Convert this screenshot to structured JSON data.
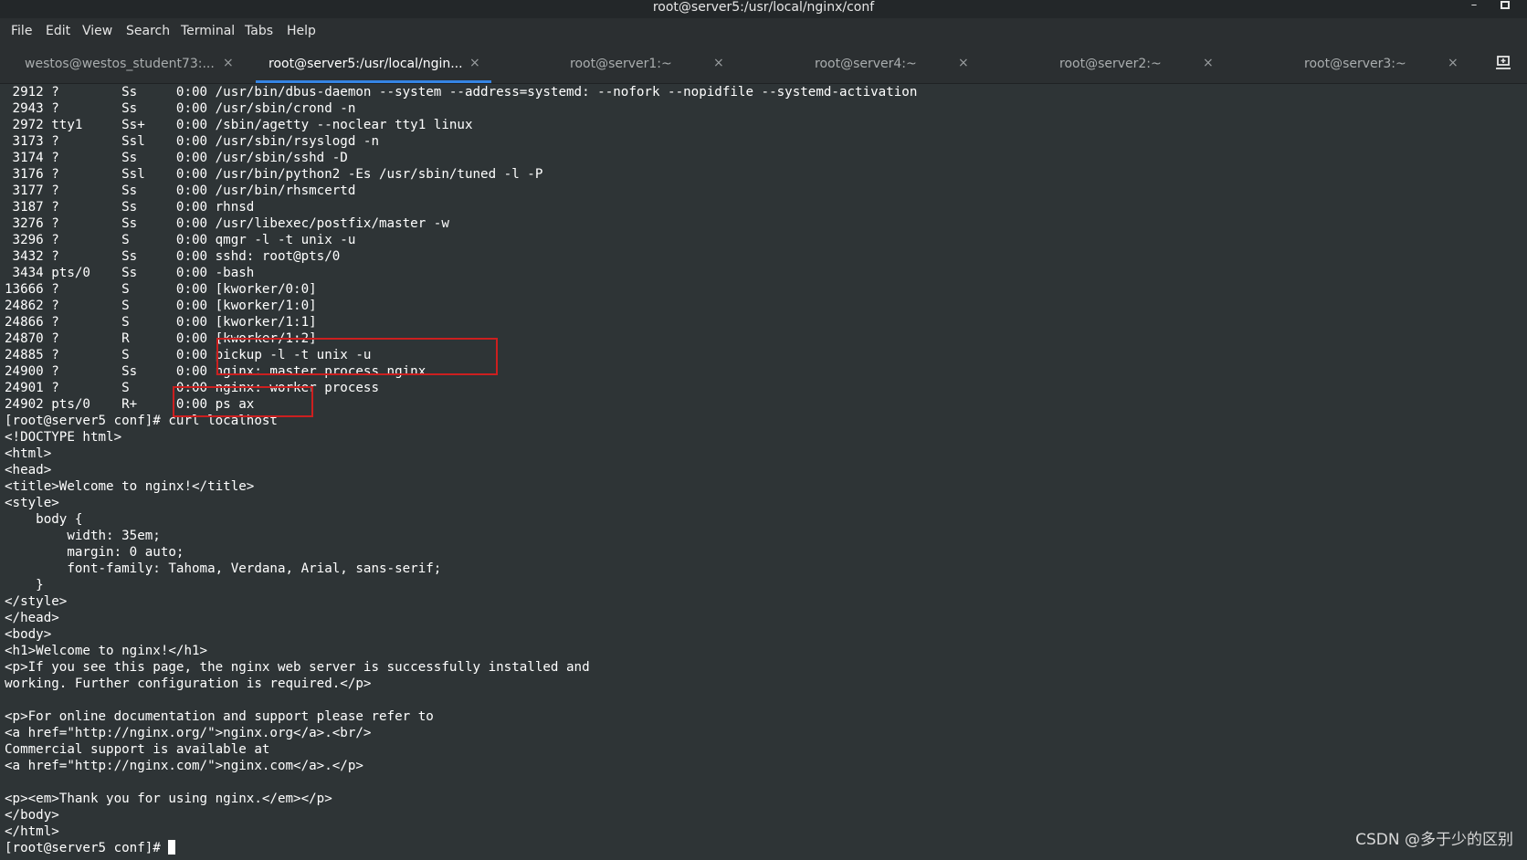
{
  "window": {
    "title": "root@server5:/usr/local/nginx/conf",
    "minimize_glyph": "–",
    "maximize_glyph": "▫"
  },
  "menu": [
    "File",
    "Edit",
    "View",
    "Search",
    "Terminal",
    "Tabs",
    "Help"
  ],
  "tabs": [
    {
      "label": "westos@westos_student73:...",
      "active": false
    },
    {
      "label": "root@server5:/usr/local/ngin...",
      "active": true
    },
    {
      "label": "root@server1:~",
      "active": false
    },
    {
      "label": "root@server4:~",
      "active": false
    },
    {
      "label": "root@server2:~",
      "active": false
    },
    {
      "label": "root@server3:~",
      "active": false
    }
  ],
  "tab_close_glyph": "×",
  "accent_color": "#3584e4",
  "highlight_color": "#cc1f1f",
  "terminal": {
    "lines": [
      " 2912 ?        Ss     0:00 /usr/bin/dbus-daemon --system --address=systemd: --nofork --nopidfile --systemd-activation",
      " 2943 ?        Ss     0:00 /usr/sbin/crond -n",
      " 2972 tty1     Ss+    0:00 /sbin/agetty --noclear tty1 linux",
      " 3173 ?        Ssl    0:00 /usr/sbin/rsyslogd -n",
      " 3174 ?        Ss     0:00 /usr/sbin/sshd -D",
      " 3176 ?        Ssl    0:00 /usr/bin/python2 -Es /usr/sbin/tuned -l -P",
      " 3177 ?        Ss     0:00 /usr/bin/rhsmcertd",
      " 3187 ?        Ss     0:00 rhnsd",
      " 3276 ?        Ss     0:00 /usr/libexec/postfix/master -w",
      " 3296 ?        S      0:00 qmgr -l -t unix -u",
      " 3432 ?        Ss     0:00 sshd: root@pts/0",
      " 3434 pts/0    Ss     0:00 -bash",
      "13666 ?        S      0:00 [kworker/0:0]",
      "24862 ?        S      0:00 [kworker/1:0]",
      "24866 ?        S      0:00 [kworker/1:1]",
      "24870 ?        R      0:00 [kworker/1:2]",
      "24885 ?        S      0:00 pickup -l -t unix -u",
      "24900 ?        Ss     0:00 nginx: master process nginx",
      "24901 ?        S      0:00 nginx: worker process",
      "24902 pts/0    R+     0:00 ps ax",
      "[root@server5 conf]# curl localhost",
      "<!DOCTYPE html>",
      "<html>",
      "<head>",
      "<title>Welcome to nginx!</title>",
      "<style>",
      "    body {",
      "        width: 35em;",
      "        margin: 0 auto;",
      "        font-family: Tahoma, Verdana, Arial, sans-serif;",
      "    }",
      "</style>",
      "</head>",
      "<body>",
      "<h1>Welcome to nginx!</h1>",
      "<p>If you see this page, the nginx web server is successfully installed and",
      "working. Further configuration is required.</p>",
      "",
      "<p>For online documentation and support please refer to",
      "<a href=\"http://nginx.org/\">nginx.org</a>.<br/>",
      "Commercial support is available at",
      "<a href=\"http://nginx.com/\">nginx.com</a>.</p>",
      "",
      "<p><em>Thank you for using nginx.</em></p>",
      "</body>",
      "</html>"
    ],
    "prompt": "[root@server5 conf]# "
  },
  "watermark": "CSDN @多于少的区别"
}
